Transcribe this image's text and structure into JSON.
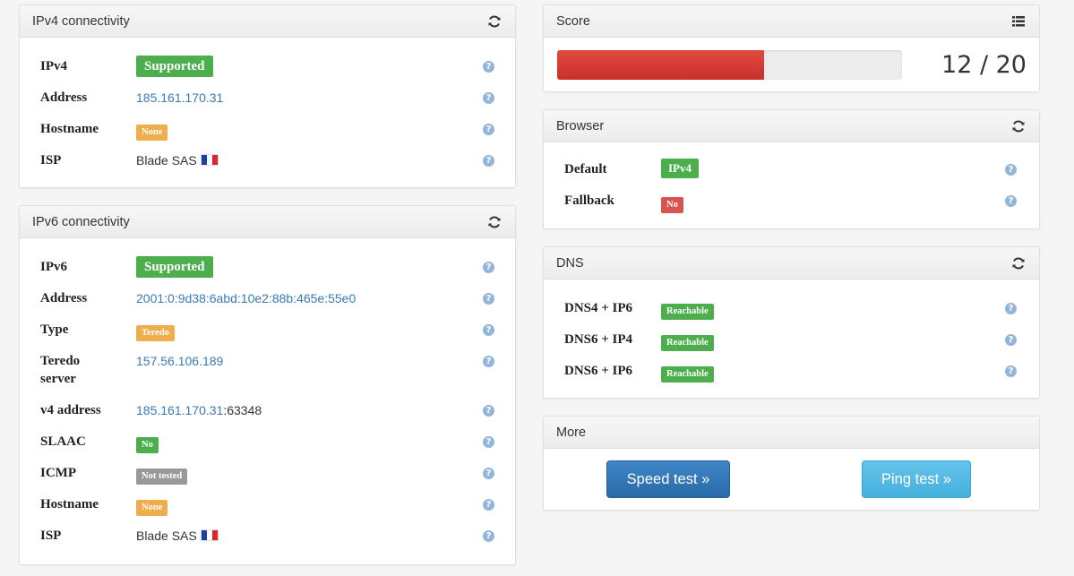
{
  "ipv4": {
    "title": "IPv4 connectivity",
    "rows": [
      {
        "label": "IPv4",
        "value": "Supported"
      },
      {
        "label": "Address",
        "value": "185.161.170.31"
      },
      {
        "label": "Hostname",
        "value": "None"
      },
      {
        "label": "ISP",
        "value": "Blade SAS"
      }
    ]
  },
  "ipv6": {
    "title": "IPv6 connectivity",
    "rows": [
      {
        "label": "IPv6",
        "value": "Supported"
      },
      {
        "label": "Address",
        "value": "2001:0:9d38:6abd:10e2:88b:465e:55e0"
      },
      {
        "label": "Type",
        "value": "Teredo"
      },
      {
        "label": "Teredo server",
        "label_line1": "Teredo",
        "label_line2": "server",
        "value": "157.56.106.189"
      },
      {
        "label": "v4 address",
        "value_ip": "185.161.170.31",
        "value_port": ":63348"
      },
      {
        "label": "SLAAC",
        "value": "No"
      },
      {
        "label": "ICMP",
        "value": "Not tested"
      },
      {
        "label": "Hostname",
        "value": "None"
      },
      {
        "label": "ISP",
        "value": "Blade SAS"
      }
    ]
  },
  "score": {
    "title": "Score",
    "value_text": "12 / 20",
    "fraction": 0.6,
    "bar_color": "#d9372c"
  },
  "browser": {
    "title": "Browser",
    "rows": [
      {
        "label": "Default",
        "value": "IPv4"
      },
      {
        "label": "Fallback",
        "value": "No"
      }
    ]
  },
  "dns": {
    "title": "DNS",
    "rows": [
      {
        "label": "DNS4 + IP6",
        "value": "Reachable"
      },
      {
        "label": "DNS6 + IP4",
        "value": "Reachable"
      },
      {
        "label": "DNS6 + IP6",
        "value": "Reachable"
      }
    ]
  },
  "more": {
    "title": "More",
    "speed_test": "Speed test »",
    "ping_test": "Ping test »"
  },
  "colors": {
    "green": "#4cae4c",
    "orange": "#f0ad4e",
    "red": "#d9534f",
    "grey": "#999999",
    "link": "#3a7ab8"
  }
}
